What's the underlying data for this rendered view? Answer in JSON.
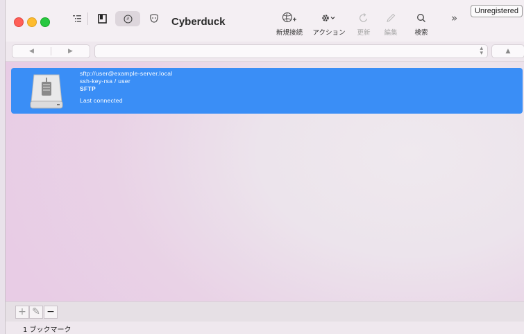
{
  "window": {
    "title": "Cyberduck"
  },
  "toolbar": {
    "new_connection_label": "新規接続",
    "action_label": "アクション",
    "refresh_label": "更新",
    "edit_label": "編集",
    "search_label": "検索",
    "more_glyph": "»",
    "unregistered_label": "Unregistered"
  },
  "navbar": {
    "back_glyph": "◀",
    "forward_glyph": "▶",
    "up_glyph": "▲",
    "path_value": ""
  },
  "bookmarks": [
    {
      "icon": "hard-disk-icon",
      "line1": "sftp://user@example-server.local",
      "line2": "ssh-key-rsa / user",
      "line3": "SFTP",
      "line4": "Last connected"
    }
  ],
  "bottom": {
    "add_glyph": "+",
    "edit_glyph": "✎",
    "delete_glyph": "−"
  },
  "status": {
    "count_text": "1 ブックマーク"
  },
  "colors": {
    "selection": "#3a8ef6",
    "close": "#ff5f57",
    "minimize": "#febc2e",
    "zoom": "#28c840"
  }
}
